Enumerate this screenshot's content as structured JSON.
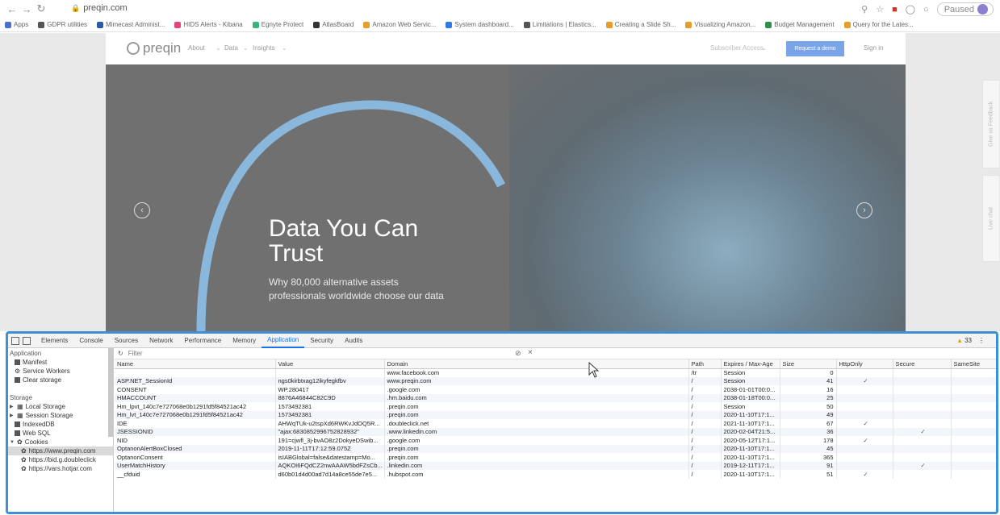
{
  "browser": {
    "url": "preqin.com",
    "paused_label": "Paused",
    "bookmarks": [
      {
        "label": "Apps",
        "color": "#4a6fd0"
      },
      {
        "label": "GDPR utilities",
        "color": "#555"
      },
      {
        "label": "Mimecast Administ...",
        "color": "#2a5aa8"
      },
      {
        "label": "HIDS Alerts - Kibana",
        "color": "#e0457b"
      },
      {
        "label": "Egnyte Protect",
        "color": "#36b37e"
      },
      {
        "label": "AtlasBoard",
        "color": "#333"
      },
      {
        "label": "Amazon Web Servic...",
        "color": "#e89c2a"
      },
      {
        "label": "System dashboard...",
        "color": "#2f7ae5"
      },
      {
        "label": "Limitations | Elastics...",
        "color": "#555"
      },
      {
        "label": "Creating a Slide Sh...",
        "color": "#e89c2a"
      },
      {
        "label": "Visualizing Amazon...",
        "color": "#e89c2a"
      },
      {
        "label": "Budget Management",
        "color": "#2f8f4f"
      },
      {
        "label": "Query for the Lates...",
        "color": "#e89c2a"
      }
    ]
  },
  "site": {
    "logo": "preqin",
    "nav": [
      "About",
      "Data",
      "Insights"
    ],
    "subscriber_access": "Subscriber Access",
    "request_demo": "Request a demo",
    "sign_in": "Sign in",
    "hero_title_line1": "Data You Can",
    "hero_title_line2": "Trust",
    "hero_sub": "Why 80,000 alternative assets professionals worldwide choose our data",
    "side_feedback": "Give us Feedback",
    "side_chat": "Live chat"
  },
  "devtools": {
    "tabs": [
      "Elements",
      "Console",
      "Sources",
      "Network",
      "Performance",
      "Memory",
      "Application",
      "Security",
      "Audits"
    ],
    "active_tab": "Application",
    "warnings": "33",
    "filter_placeholder": "Filter",
    "sidebar": {
      "application_head": "Application",
      "application_items": [
        "Manifest",
        "Service Workers",
        "Clear storage"
      ],
      "storage_head": "Storage",
      "storage_items": [
        "Local Storage",
        "Session Storage",
        "IndexedDB",
        "Web SQL",
        "Cookies"
      ],
      "cookie_origins": [
        "https://www.preqin.com",
        "https://bid.g.doubleclick",
        "https://vars.hotjar.com"
      ]
    },
    "columns": [
      "Name",
      "Value",
      "Domain",
      "Path",
      "Expires / Max-Age",
      "Size",
      "HttpOnly",
      "Secure",
      "SameSite"
    ],
    "rows": [
      {
        "name": "",
        "value": "",
        "domain": "www.facebook.com",
        "path": "/tr",
        "expires": "Session",
        "size": "0",
        "httponly": "",
        "secure": "",
        "samesite": ""
      },
      {
        "name": "ASP.NET_SessionId",
        "value": "ngs0kirbtxag12ikyfegkfbv",
        "domain": "www.preqin.com",
        "path": "/",
        "expires": "Session",
        "size": "41",
        "httponly": "✓",
        "secure": "",
        "samesite": ""
      },
      {
        "name": "CONSENT",
        "value": "WP.280417",
        "domain": ".google.com",
        "path": "/",
        "expires": "2038-01-01T00:0...",
        "size": "16",
        "httponly": "",
        "secure": "",
        "samesite": ""
      },
      {
        "name": "HMACCOUNT",
        "value": "8876A46844C82C9D",
        "domain": ".hm.baidu.com",
        "path": "/",
        "expires": "2038-01-18T00:0...",
        "size": "25",
        "httponly": "",
        "secure": "",
        "samesite": ""
      },
      {
        "name": "Hm_lpvt_140c7e727068e0b1291fd5f84521ac42",
        "value": "1573492381",
        "domain": ".preqin.com",
        "path": "/",
        "expires": "Session",
        "size": "50",
        "httponly": "",
        "secure": "",
        "samesite": ""
      },
      {
        "name": "Hm_lvt_140c7e727068e0b1291fd5f84521ac42",
        "value": "1573492381",
        "domain": ".preqin.com",
        "path": "/",
        "expires": "2020-11-10T17:1...",
        "size": "49",
        "httponly": "",
        "secure": "",
        "samesite": ""
      },
      {
        "name": "IDE",
        "value": "AHWqTUk-u2tspXd6RWKvJdOQ5R...",
        "domain": ".doubleclick.net",
        "path": "/",
        "expires": "2021-11-10T17:1...",
        "size": "67",
        "httponly": "✓",
        "secure": "",
        "samesite": ""
      },
      {
        "name": "JSESSIONID",
        "value": "\"ajax:6830852996752828932\"",
        "domain": ".www.linkedin.com",
        "path": "/",
        "expires": "2020-02-04T21:5...",
        "size": "36",
        "httponly": "",
        "secure": "✓",
        "samesite": ""
      },
      {
        "name": "NID",
        "value": "191=cjwfl_3j-bvAO8z2DokyeDSwib...",
        "domain": ".google.com",
        "path": "/",
        "expires": "2020-05-12T17:1...",
        "size": "178",
        "httponly": "✓",
        "secure": "",
        "samesite": ""
      },
      {
        "name": "OptanonAlertBoxClosed",
        "value": "2019-11-11T17:12:59.075Z",
        "domain": ".preqin.com",
        "path": "/",
        "expires": "2020-11-10T17:1...",
        "size": "45",
        "httponly": "",
        "secure": "",
        "samesite": ""
      },
      {
        "name": "OptanonConsent",
        "value": "isIABGlobal=false&datestamp=Mo...",
        "domain": ".preqin.com",
        "path": "/",
        "expires": "2020-11-10T17:1...",
        "size": "365",
        "httponly": "",
        "secure": "",
        "samesite": ""
      },
      {
        "name": "UserMatchHistory",
        "value": "AQKOI6FQdCZ2nwAAAW5bdFZsCb...",
        "domain": ".linkedin.com",
        "path": "/",
        "expires": "2019-12-11T17:1...",
        "size": "91",
        "httponly": "",
        "secure": "✓",
        "samesite": ""
      },
      {
        "name": "__cfduid",
        "value": "d60b01d4d00ad7d14a8ce55de7e5...",
        "domain": ".hubspot.com",
        "path": "/",
        "expires": "2020-11-10T17:1...",
        "size": "51",
        "httponly": "✓",
        "secure": "",
        "samesite": ""
      }
    ]
  }
}
